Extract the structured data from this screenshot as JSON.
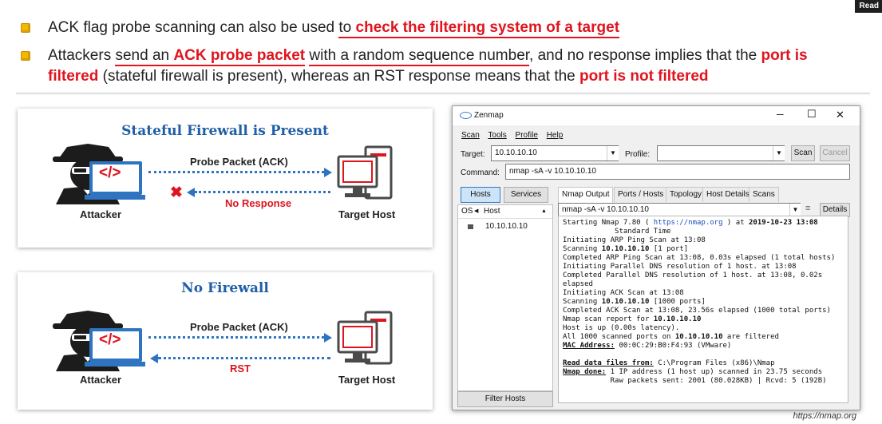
{
  "corner_tag": "Read",
  "bullets": [
    {
      "parts": [
        {
          "t": "ACK flag probe scanning can also be used ",
          "s": ""
        },
        {
          "t": "to ",
          "s": "ul"
        },
        {
          "t": "check the filtering system of a target",
          "s": "hl ul"
        }
      ]
    },
    {
      "parts": [
        {
          "t": "Attackers ",
          "s": ""
        },
        {
          "t": "send an ",
          "s": "ul"
        },
        {
          "t": "ACK probe packet",
          "s": "hl ul"
        },
        {
          "t": " ",
          "s": ""
        },
        {
          "t": "with a random sequence number",
          "s": "ul"
        },
        {
          "t": ", and no response implies that the ",
          "s": ""
        },
        {
          "t": "port is",
          "s": "hl"
        }
      ]
    },
    {
      "parts": [
        {
          "t": "filtered",
          "s": "hl"
        },
        {
          "t": " (stateful firewall is present), whereas an RST response means that the ",
          "s": ""
        },
        {
          "t": "port is not filtered",
          "s": "hl"
        }
      ]
    }
  ],
  "diagram_top": {
    "title": "Stateful Firewall is Present",
    "probe": "Probe Packet (ACK)",
    "response": "No Response",
    "attacker": "Attacker",
    "target": "Target Host",
    "code_glyph": "</>"
  },
  "diagram_bottom": {
    "title": "No Firewall",
    "probe": "Probe Packet (ACK)",
    "response": "RST",
    "attacker": "Attacker",
    "target": "Target Host",
    "code_glyph": "</>"
  },
  "zenmap": {
    "title": "Zenmap",
    "menu": [
      "Scan",
      "Tools",
      "Profile",
      "Help"
    ],
    "target_label": "Target:",
    "target_value": "10.10.10.10",
    "profile_label": "Profile:",
    "profile_value": "",
    "scan_btn": "Scan",
    "cancel_btn": "Cancel",
    "command_label": "Command:",
    "command_value": "nmap -sA -v 10.10.10.10",
    "hosts_btn": "Hosts",
    "services_btn": "Services",
    "col_os": "OS",
    "col_host": "Host",
    "host_item": "10.10.10.10",
    "filter_btn": "Filter Hosts",
    "tabs": [
      "Nmap Output",
      "Ports / Hosts",
      "Topology",
      "Host Details",
      "Scans"
    ],
    "output_select": "nmap -sA -v 10.10.10.10",
    "details_btn": "Details",
    "output_lines": [
      [
        {
          "t": "Starting Nmap 7.80 ( "
        },
        {
          "t": "https://nmap.org",
          "c": "link"
        },
        {
          "t": " ) at "
        },
        {
          "t": "2019-10-23 13:08",
          "c": "b"
        }
      ],
      [
        {
          "t": "            Standard Time"
        }
      ],
      [
        {
          "t": "Initiating ARP Ping Scan at 13:08"
        }
      ],
      [
        {
          "t": "Scanning "
        },
        {
          "t": "10.10.10.10",
          "c": "b"
        },
        {
          "t": " [1 port]"
        }
      ],
      [
        {
          "t": "Completed ARP Ping Scan at 13:08, 0.03s elapsed (1 total hosts)"
        }
      ],
      [
        {
          "t": "Initiating Parallel DNS resolution of 1 host. at 13:08"
        }
      ],
      [
        {
          "t": "Completed Parallel DNS resolution of 1 host. at 13:08, 0.02s"
        }
      ],
      [
        {
          "t": "elapsed"
        }
      ],
      [
        {
          "t": "Initiating ACK Scan at 13:08"
        }
      ],
      [
        {
          "t": "Scanning "
        },
        {
          "t": "10.10.10.10",
          "c": "b"
        },
        {
          "t": " [1000 ports]"
        }
      ],
      [
        {
          "t": "Completed ACK Scan at 13:08, 23.56s elapsed (1000 total ports)"
        }
      ],
      [
        {
          "t": "Nmap scan report for "
        },
        {
          "t": "10.10.10.10",
          "c": "b"
        }
      ],
      [
        {
          "t": "Host is up (0.00s latency)."
        }
      ],
      [
        {
          "t": "All 1000 scanned ports on "
        },
        {
          "t": "10.10.10.10",
          "c": "b"
        },
        {
          "t": " are filtered"
        }
      ],
      [
        {
          "t": "MAC Address:",
          "c": "bu"
        },
        {
          "t": " 00:0C:29:B0:F4:93 (VMware)"
        }
      ],
      [
        {
          "t": " "
        }
      ],
      [
        {
          "t": "Read data files from:",
          "c": "bu"
        },
        {
          "t": " C:\\Program Files (x86)\\Nmap"
        }
      ],
      [
        {
          "t": "Nmap done:",
          "c": "bu"
        },
        {
          "t": " 1 IP address (1 host up) scanned in 23.75 seconds"
        }
      ],
      [
        {
          "t": "           Raw packets sent: 2001 (80.028KB) | Rcvd: 5 (192B)"
        }
      ]
    ]
  },
  "credit": "https://nmap.org",
  "colors": {
    "accent_red": "#e0141e",
    "diagram_blue": "#2f74c0",
    "bullet_yellow": "#f2b705",
    "hacker_dark": "#1c1c1c"
  }
}
